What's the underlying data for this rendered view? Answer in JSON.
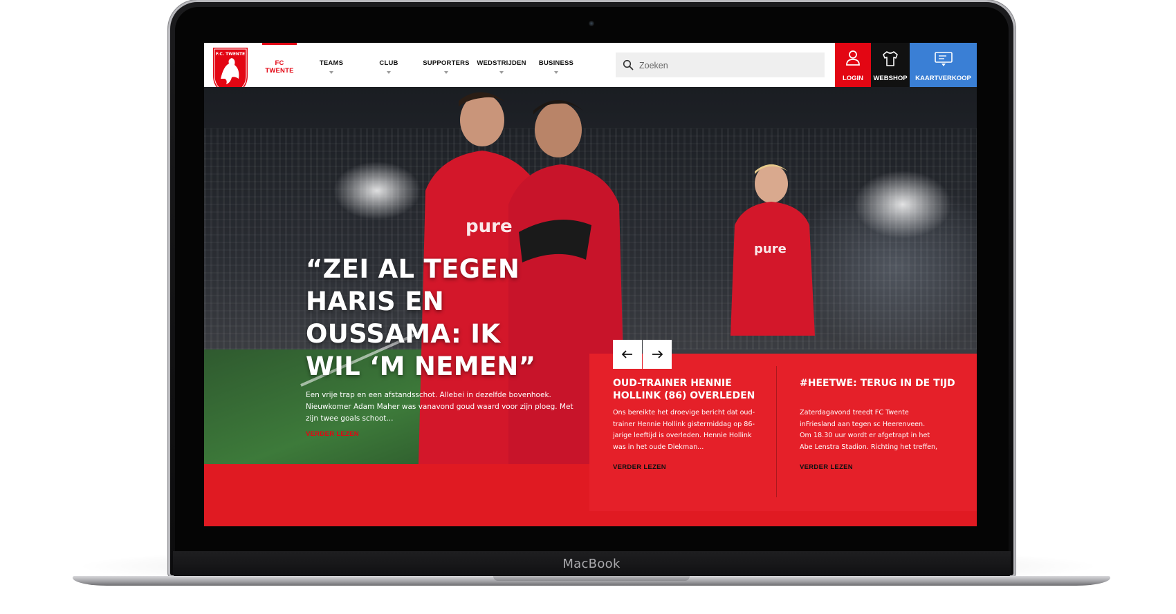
{
  "device": {
    "brand_label": "MacBook"
  },
  "header": {
    "logo": {
      "text_top": "F.C. TWENTE",
      "year": "1965"
    },
    "nav": [
      {
        "label": "FC TWENTE",
        "active": true,
        "has_dropdown": false
      },
      {
        "label": "TEAMS",
        "active": false,
        "has_dropdown": true
      },
      {
        "label": "CLUB",
        "active": false,
        "has_dropdown": true
      },
      {
        "label": "SUPPORTERS",
        "active": false,
        "has_dropdown": true
      },
      {
        "label": "WEDSTRIJDEN",
        "active": false,
        "has_dropdown": true
      },
      {
        "label": "BUSINESS",
        "active": false,
        "has_dropdown": true
      }
    ],
    "search": {
      "placeholder": "Zoeken",
      "value": ""
    },
    "buttons": {
      "login": "LOGIN",
      "webshop": "WEBSHOP",
      "tickets": "KAARTVERKOOP"
    }
  },
  "hero": {
    "title": "“ZEI AL TEGEN HARIS EN OUSSAMA: IK WIL ‘M NEMEN”",
    "body": "Een vrije trap en een afstandsschot. Allebei in dezelfde bovenhoek. Nieuwkomer Adam Maher was vanavond goud waard voor zijn ploeg. Met zijn twee goals schoot...",
    "more": "VERDER LEZEN"
  },
  "news": [
    {
      "title": "OUD-TRAINER HENNIE HOLLINK (86) OVERLEDEN",
      "text": "Ons bereikte het droevige bericht dat oud-trainer Hennie Hollink gistermiddag op 86-jarige leeftijd is overleden. Hennie Hollink was in het oude Diekman...",
      "more": "VERDER LEZEN"
    },
    {
      "title": "#HEETWE: TERUG IN DE TIJD",
      "text": "Zaterdagavond treedt FC Twente inFriesland aan tegen sc Heerenveen. Om 18.30 uur wordt er afgetrapt in het Abe Lenstra Stadion. Richting het treffen,",
      "more": "VERDER LEZEN"
    }
  ],
  "colors": {
    "brand_red": "#e30613",
    "panel_red": "#e52029",
    "ticket_blue": "#3a7fd5",
    "webshop_black": "#111111"
  }
}
